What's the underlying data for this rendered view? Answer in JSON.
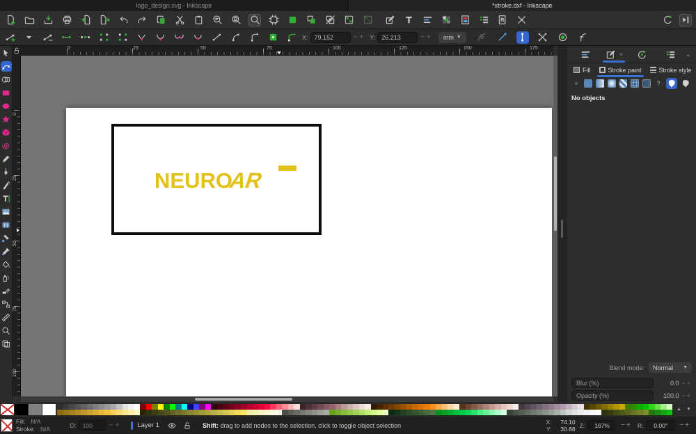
{
  "window": {
    "tab_left": "logo_design.svg - Inkscape",
    "tab_right": "*stroke.dxf - Inkscape"
  },
  "toolbar_main": {
    "left": [
      {
        "n": "new-document-button",
        "i": "docNew"
      },
      {
        "n": "open-document-button",
        "i": "folder"
      },
      {
        "n": "save-document-button",
        "i": "save"
      },
      {
        "n": "print-button",
        "i": "print"
      },
      {
        "n": "import-button",
        "i": "import"
      },
      {
        "n": "export-button",
        "i": "export"
      },
      {
        "n": "undo-button",
        "i": "undo"
      },
      {
        "n": "redo-button",
        "i": "redo"
      },
      {
        "n": "copy-button",
        "i": "copy"
      },
      {
        "n": "cut-button",
        "i": "cut"
      },
      {
        "n": "paste-button",
        "i": "paste"
      },
      {
        "n": "zoom-drawing-button",
        "i": "zoomDraw"
      },
      {
        "n": "zoom-page-button",
        "i": "zoomPage"
      },
      {
        "n": "zoom-selection-button",
        "i": "zoom",
        "box": true
      },
      {
        "n": "page-frame-button",
        "i": "frame"
      },
      {
        "n": "duplicate-button",
        "i": "dup"
      },
      {
        "n": "create-clone-button",
        "i": "clone"
      },
      {
        "n": "unlink-clone-button",
        "i": "cloneX"
      },
      {
        "n": "group-button",
        "i": "group"
      },
      {
        "n": "ungroup-button",
        "i": "group",
        "faded": true
      }
    ],
    "mid": [
      {
        "n": "fill-stroke-dialog-button",
        "i": "fillstroke"
      },
      {
        "n": "text-dialog-button",
        "i": "text"
      },
      {
        "n": "align-dialog-button",
        "i": "align"
      },
      {
        "n": "swatches-dialog-button",
        "i": "swatches"
      },
      {
        "n": "document-properties-button",
        "i": "docprops"
      },
      {
        "n": "objects-dialog-button",
        "i": "objects"
      },
      {
        "n": "find-replace-button",
        "i": "find"
      },
      {
        "n": "preferences-button",
        "i": "prefs"
      }
    ],
    "right": [
      {
        "n": "rotate-view-button",
        "i": "rotate"
      },
      {
        "n": "snap-controls-toggle",
        "i": "snapbar",
        "box": true
      }
    ]
  },
  "toolbar_node": {
    "left": [
      {
        "n": "insert-node-button",
        "i": "nInsert"
      },
      {
        "n": "insert-node-menu-button",
        "i": "chevD"
      },
      {
        "n": "delete-node-button",
        "i": "nDelete"
      },
      {
        "n": "break-nodes-button",
        "i": "nBreak"
      },
      {
        "n": "join-nodes-button",
        "i": "nJoin"
      },
      {
        "n": "join-with-segment-button",
        "i": "nJoinS"
      },
      {
        "n": "delete-segment-button",
        "i": "nDelS"
      },
      {
        "n": "node-corner-button",
        "i": "nCorner"
      },
      {
        "n": "node-smooth-button",
        "i": "nSmooth"
      },
      {
        "n": "node-symmetric-button",
        "i": "nSym"
      },
      {
        "n": "node-auto-smooth-button",
        "i": "nAuto"
      },
      {
        "n": "segment-line-button",
        "i": "segL"
      },
      {
        "n": "segment-curve-button",
        "i": "segC"
      },
      {
        "n": "add-corners-lpe-button",
        "i": "segC2"
      },
      {
        "n": "object-to-path-button",
        "i": "o2p"
      },
      {
        "n": "stroke-to-path-button",
        "i": "s2p"
      }
    ],
    "fields": {
      "x_label": "X:",
      "x_value": "79.152",
      "y_label": "Y:",
      "y_value": "26.213",
      "unit": "mm"
    },
    "right": [
      {
        "n": "edit-clip-toggle",
        "i": "clipFade",
        "faded": true
      },
      {
        "n": "edit-mask-toggle",
        "i": "clipPen"
      },
      {
        "n": "show-handles-toggle",
        "i": "handleBox",
        "blue": true
      },
      {
        "n": "show-transform-handles-toggle",
        "i": "xArrows"
      },
      {
        "n": "mask-visibility-toggle",
        "i": "maskC"
      },
      {
        "n": "show-path-outline-toggle",
        "i": "fCurve"
      }
    ]
  },
  "tools": [
    {
      "n": "tool-selector",
      "i": "tSelect"
    },
    {
      "n": "tool-node-editor",
      "i": "tNode",
      "blue": true
    },
    {
      "n": "tool-shape-builder",
      "i": "tBuild"
    },
    {
      "n": "tool-rectangle",
      "i": "tRect"
    },
    {
      "n": "tool-ellipse",
      "i": "tEllipse"
    },
    {
      "n": "tool-star",
      "i": "tStar"
    },
    {
      "n": "tool-3d-box",
      "i": "tBox"
    },
    {
      "n": "tool-spiral",
      "i": "tSpiral"
    },
    {
      "n": "tool-pencil",
      "i": "tPencil"
    },
    {
      "n": "tool-pen",
      "i": "tPen"
    },
    {
      "n": "tool-calligraphy",
      "i": "tCallig"
    },
    {
      "n": "tool-text",
      "i": "tText"
    },
    {
      "n": "tool-gradient",
      "i": "tGrad"
    },
    {
      "n": "tool-mesh-gradient",
      "i": "tMesh"
    },
    {
      "n": "tool-tweak",
      "i": "tTweak"
    },
    {
      "n": "tool-dropper",
      "i": "tDrop"
    },
    {
      "n": "tool-paint-bucket",
      "i": "tBucket"
    },
    {
      "n": "tool-spray",
      "i": "tSpray"
    },
    {
      "n": "tool-eraser",
      "i": "tErase"
    },
    {
      "n": "tool-connector",
      "i": "tConn"
    },
    {
      "n": "tool-measure",
      "i": "tMeasure"
    },
    {
      "n": "tool-zoom",
      "i": "tZoom"
    },
    {
      "n": "tool-pages",
      "i": "tPages"
    }
  ],
  "rulers": {
    "h": [
      {
        "t": "0",
        "p": 66
      },
      {
        "t": "25",
        "p": 160
      },
      {
        "t": "50",
        "p": 257
      },
      {
        "t": "75",
        "p": 352
      },
      {
        "t": "100",
        "p": 447
      },
      {
        "t": "125",
        "p": 542
      },
      {
        "t": "150",
        "p": 635
      },
      {
        "t": "175",
        "p": 730
      }
    ],
    "v": [
      {
        "t": "0",
        "p": 78
      },
      {
        "t": "25",
        "p": 172
      },
      {
        "t": "50",
        "p": 266
      },
      {
        "t": "75",
        "p": 360
      },
      {
        "t": "100",
        "p": 454
      }
    ]
  },
  "canvas": {
    "logo_main": "NEURO",
    "logo_accent": "AR",
    "logo_color": "#e3c118"
  },
  "right_panel": {
    "dock_tabs": [
      {
        "n": "dialog-tab-align",
        "i": "dAlign"
      },
      {
        "n": "dialog-tab-fill-stroke",
        "i": "dFS",
        "active": true,
        "close": "×"
      },
      {
        "n": "dialog-tab-undo-history",
        "i": "dHist"
      },
      {
        "n": "dialog-tab-objects",
        "i": "dObj"
      }
    ],
    "dock_chevron": "⌄",
    "subtabs": [
      {
        "label": "Fill",
        "n": "tab-fill",
        "icon": "fillsq"
      },
      {
        "label": "Stroke paint",
        "n": "tab-stroke-paint",
        "icon": "strokesq",
        "active": true
      },
      {
        "label": "Stroke style",
        "n": "tab-stroke-style",
        "icon": "strokelines"
      }
    ],
    "paint_types": [
      {
        "n": "paint-none-button",
        "kind": "none",
        "glyph": "×"
      },
      {
        "n": "paint-flat-button",
        "kind": "flat"
      },
      {
        "n": "paint-linear-gradient-button",
        "kind": "linear"
      },
      {
        "n": "paint-radial-gradient-button",
        "kind": "radial"
      },
      {
        "n": "paint-pattern-button",
        "kind": "pattern"
      },
      {
        "n": "paint-mesh-gradient-button",
        "kind": "mesh"
      },
      {
        "n": "paint-swatch-button",
        "kind": "swatch"
      },
      {
        "n": "paint-unknown-button",
        "kind": "unknown",
        "glyph": "?"
      }
    ],
    "fill_rules": [
      {
        "n": "fill-rule-nonzero-button",
        "sel": true
      },
      {
        "n": "fill-rule-evenodd-button",
        "sel": false
      }
    ],
    "message": "No objects",
    "blend": {
      "label": "Blend mode:",
      "value": "Normal"
    },
    "blur": {
      "label": "Blur (%)",
      "value": "0.0"
    },
    "opacity": {
      "label": "Opacity (%)",
      "value": "100.0"
    }
  },
  "palette": {
    "pinned": [
      {
        "n": "swatch-none",
        "kind": "none"
      },
      {
        "n": "swatch-black",
        "c": "#000000"
      },
      {
        "n": "swatch-gray",
        "c": "#808080"
      },
      {
        "n": "swatch-white",
        "c": "#ffffff"
      }
    ],
    "row_top": [
      "#2e2e2e",
      "#3a3a3a",
      "#474747",
      "#545454",
      "#616161",
      "#6f6f6f",
      "#7d7d7d",
      "#8b8b8b",
      "#9a9a9a",
      "#aaaaaa",
      "#c4c4c4",
      "#e2e2e2",
      "#f2f2f2",
      "#ffffff",
      "#800000",
      "#ff0000",
      "#808000",
      "#ffff00",
      "#008000",
      "#00ff00",
      "#008080",
      "#00ffff",
      "#000080",
      "#4040ff",
      "#800080",
      "#ff00ff",
      "#33000d",
      "#490012",
      "#5f0017",
      "#75001d",
      "#8b0022",
      "#a10027",
      "#b7002d",
      "#cd0032",
      "#e30038",
      "#f90d44",
      "#ff3a5e",
      "#ff6379",
      "#ff8d95",
      "#ffb6b6",
      "#ffdcda",
      "#3c232a",
      "#4e3038",
      "#603d46",
      "#724a54",
      "#845762",
      "#966470",
      "#a87e82",
      "#ba9894",
      "#ccb2ac",
      "#dec6c0",
      "#ecdad6",
      "#f7ecea",
      "#331a00",
      "#482500",
      "#5d3000",
      "#723b00",
      "#874600",
      "#9c5100",
      "#b15c00",
      "#c66700",
      "#db7200",
      "#f07d00",
      "#ff9022",
      "#ffa84e",
      "#ffc07a",
      "#ffd8a6",
      "#ffeccd",
      "#5a2f18",
      "#6f4430",
      "#845948",
      "#996e60",
      "#ae8378",
      "#c39890",
      "#d8ada8",
      "#e6c2bc",
      "#f0d7d0",
      "#f9ebe6",
      "#473740",
      "#564550",
      "#655360",
      "#746170",
      "#836f80",
      "#927d8e",
      "#a18b9c",
      "#b39dac",
      "#c5b3bf",
      "#d7c9d1",
      "#eadfe4",
      "#403400",
      "#574700",
      "#6e5a00",
      "#856d00",
      "#9c8000",
      "#b39300",
      "#caa600",
      "#3f7d00",
      "#2a9400",
      "#15ab00",
      "#00c200",
      "#35d41c",
      "#6ae24e",
      "#a0f088",
      "#d5fdc2"
    ],
    "row_bottom": [
      "#8a6d15",
      "#97781a",
      "#a4831f",
      "#b18e24",
      "#be9929",
      "#cba42e",
      "#d8af33",
      "#e5ba38",
      "#f2c53d",
      "#f6d058",
      "#f8da73",
      "#fae48e",
      "#fceea9",
      "#fef8c4",
      "#262409",
      "#32300e",
      "#3e3c13",
      "#4a4818",
      "#56541d",
      "#626022",
      "#6e6c27",
      "#7a782c",
      "#878431",
      "#948f36",
      "#a19a3b",
      "#aea540",
      "#bbb045",
      "#c8bb4a",
      "#d5c64f",
      "#e2d154",
      "#efdc59",
      "#fce75e",
      "#f3eda6",
      "#f5f0b4",
      "#f7f3c2",
      "#f9f6d0",
      "#fbf9de",
      "#fdfcec",
      "#50504a",
      "#5d5d57",
      "#6a6a64",
      "#777771",
      "#84847e",
      "#91918b",
      "#9e9e98",
      "#ababa5",
      "#69a31d",
      "#78af2c",
      "#87bb3b",
      "#96c74a",
      "#a5d359",
      "#b4df68",
      "#c3eb77",
      "#d2f786",
      "#e1fb9f",
      "#f0fdc1",
      "#0d2911",
      "#173419",
      "#213f21",
      "#2b4a29",
      "#355531",
      "#3f6039",
      "#496b41",
      "#537649",
      "#00941c",
      "#00a127",
      "#00ae32",
      "#00bb3d",
      "#00c848",
      "#0ed558",
      "#2ce26e",
      "#4aef84",
      "#68f69a",
      "#8cf9b2",
      "#b0fbca",
      "#d4fde2",
      "#39443b",
      "#465148",
      "#535e55",
      "#606b62",
      "#6d786f",
      "#7a857c",
      "#879289",
      "#949f96",
      "#a8b0aa",
      "#c0c6c2",
      "#d4d8d5",
      "#e0e3e1",
      "#eaedeb",
      "#f2f4f3",
      "#f8faf9",
      "#feffff",
      "#2a330a",
      "#36400f",
      "#424d14",
      "#4e5a19",
      "#5a671e",
      "#667423",
      "#728128",
      "#7e8e2d",
      "#24750e",
      "#1d8d12",
      "#16a516",
      "#0fbd1a"
    ],
    "controls": [
      {
        "n": "palette-scroll-up",
        "g": "▲"
      },
      {
        "n": "palette-scroll-down",
        "g": "▼"
      },
      {
        "n": "palette-menu",
        "g": "≡"
      }
    ]
  },
  "status": {
    "fill_label": "Fill:",
    "fill_value": "N/A",
    "stroke_label": "Stroke:",
    "stroke_value": "N/A",
    "opacity_label": "O:",
    "opacity_value": "100",
    "layer_label": "Layer 1",
    "hint_strong": "Shift:",
    "hint_rest": " drag to add nodes to the selection, click to toggle object selection",
    "x_label": "X:",
    "x_value": "74.10",
    "y_label": "Y:",
    "y_value": "30.88",
    "zoom_label": "Z:",
    "zoom_value": "167%",
    "rotation_label": "R:",
    "rotation_value": "0.00°"
  }
}
